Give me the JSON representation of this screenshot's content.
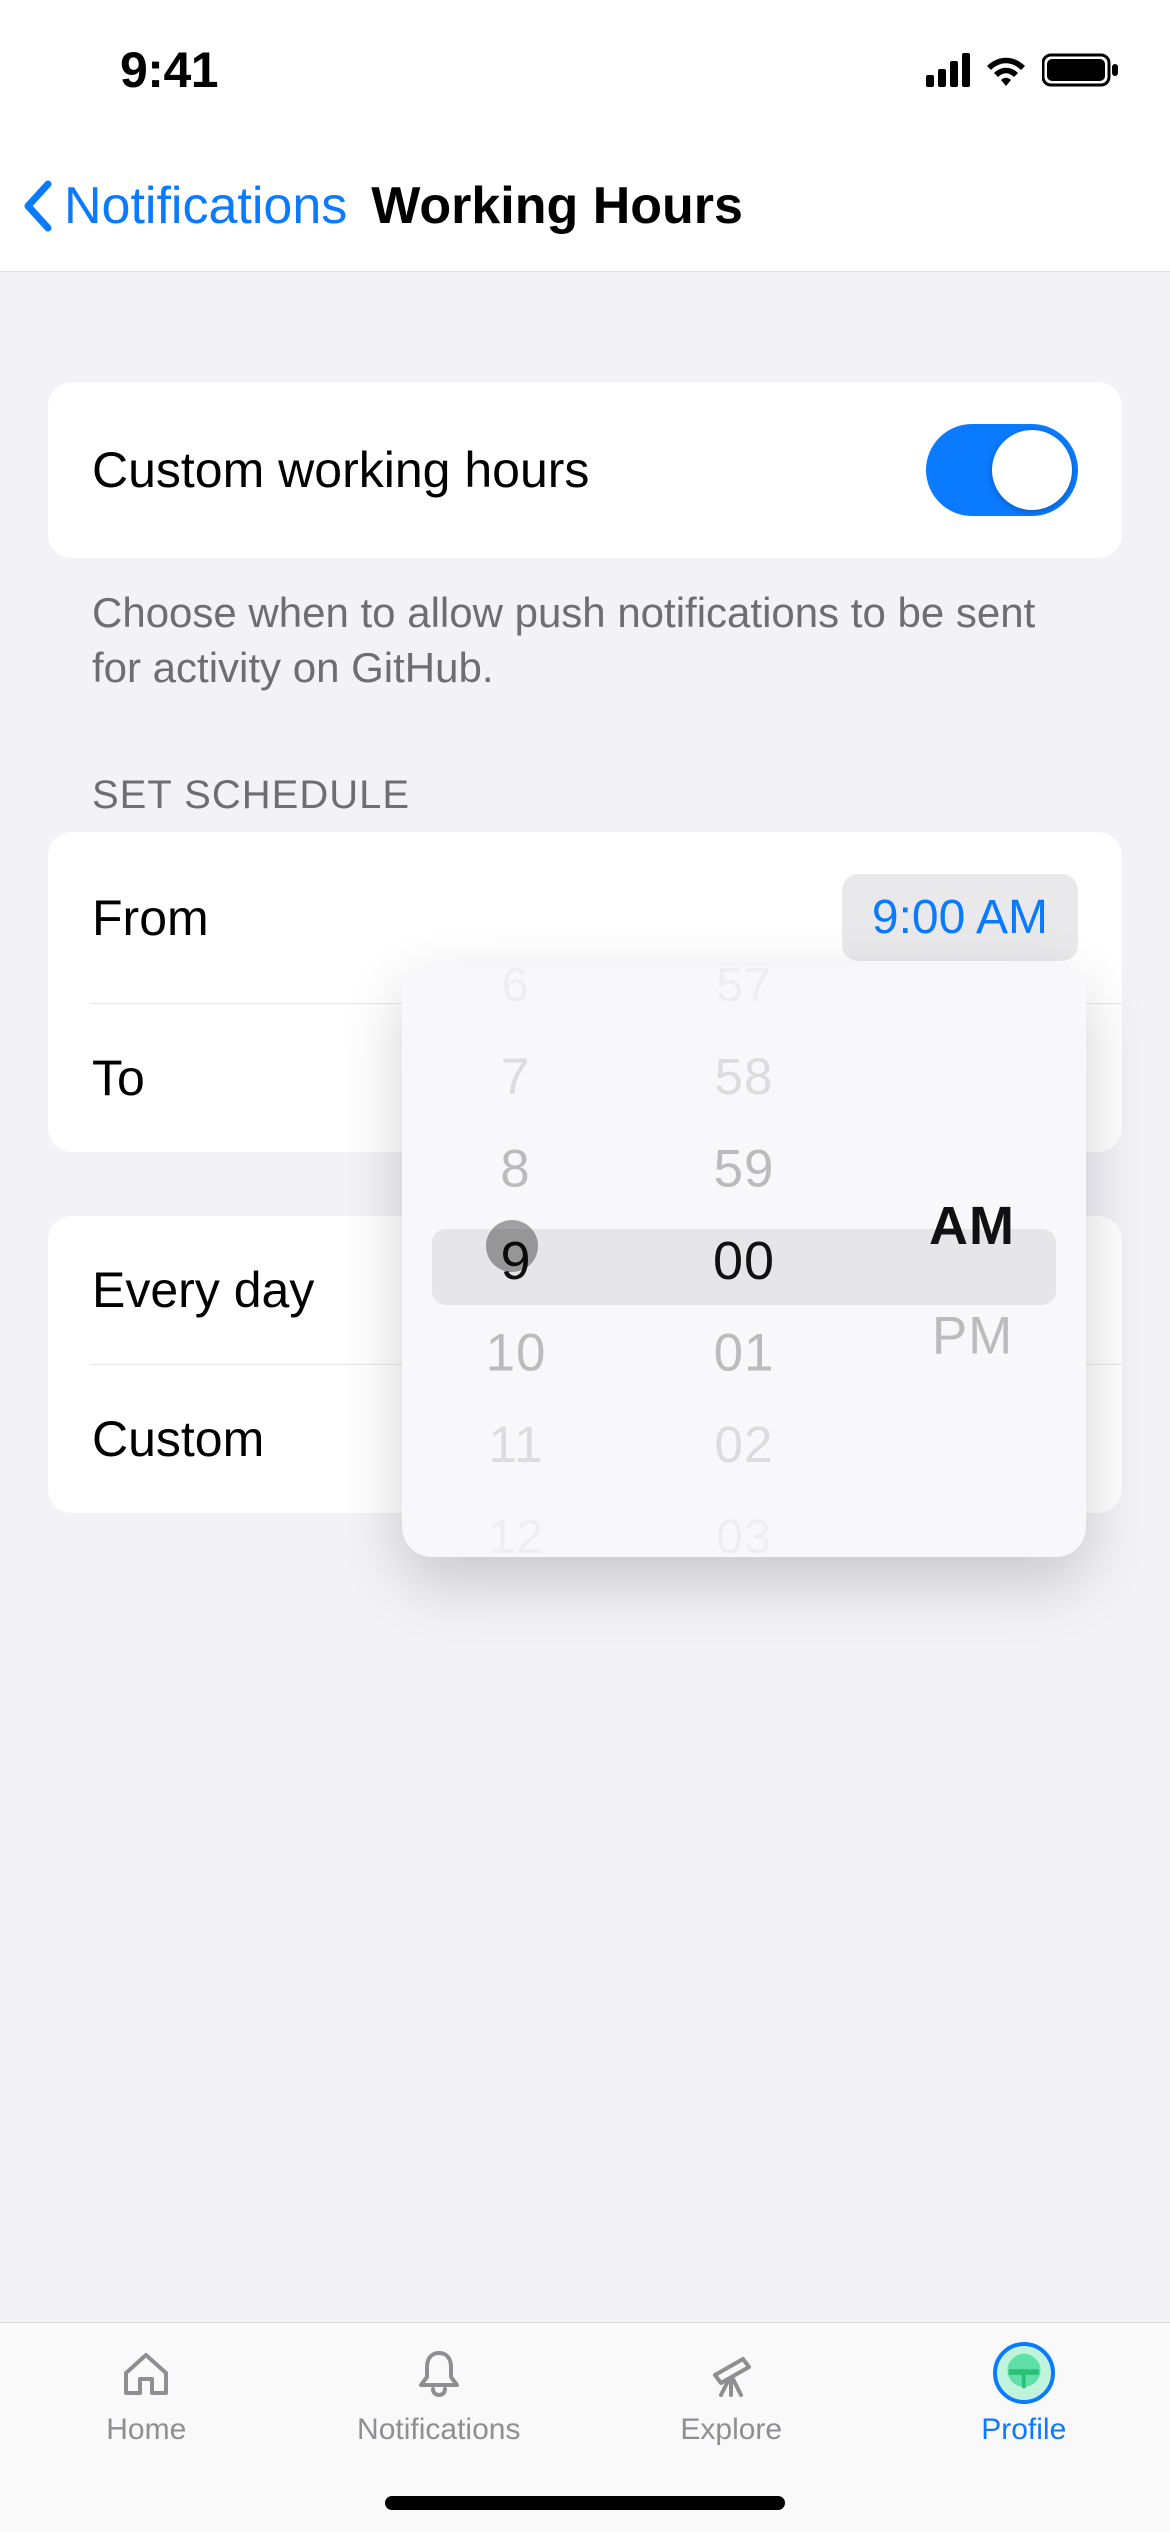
{
  "status": {
    "time": "9:41"
  },
  "nav": {
    "back_label": "Notifications",
    "title": "Working Hours"
  },
  "toggle": {
    "label": "Custom working hours",
    "on": true
  },
  "description": "Choose when to allow push notifications to be sent for activity on GitHub.",
  "schedule": {
    "header": "SET SCHEDULE",
    "from_label": "From",
    "from_value": "9:00 AM",
    "to_label": "To"
  },
  "day_type": {
    "every_label": "Every day",
    "custom_label": "Custom"
  },
  "picker": {
    "hours": [
      "6",
      "7",
      "8",
      "9",
      "10",
      "11",
      "12"
    ],
    "minutes": [
      "57",
      "58",
      "59",
      "00",
      "01",
      "02",
      "03"
    ],
    "ampm": [
      "AM",
      "PM"
    ],
    "selected": {
      "hour": "9",
      "minute": "00",
      "ampm": "AM"
    }
  },
  "tabs": {
    "home": "Home",
    "notifications": "Notifications",
    "explore": "Explore",
    "profile": "Profile"
  }
}
